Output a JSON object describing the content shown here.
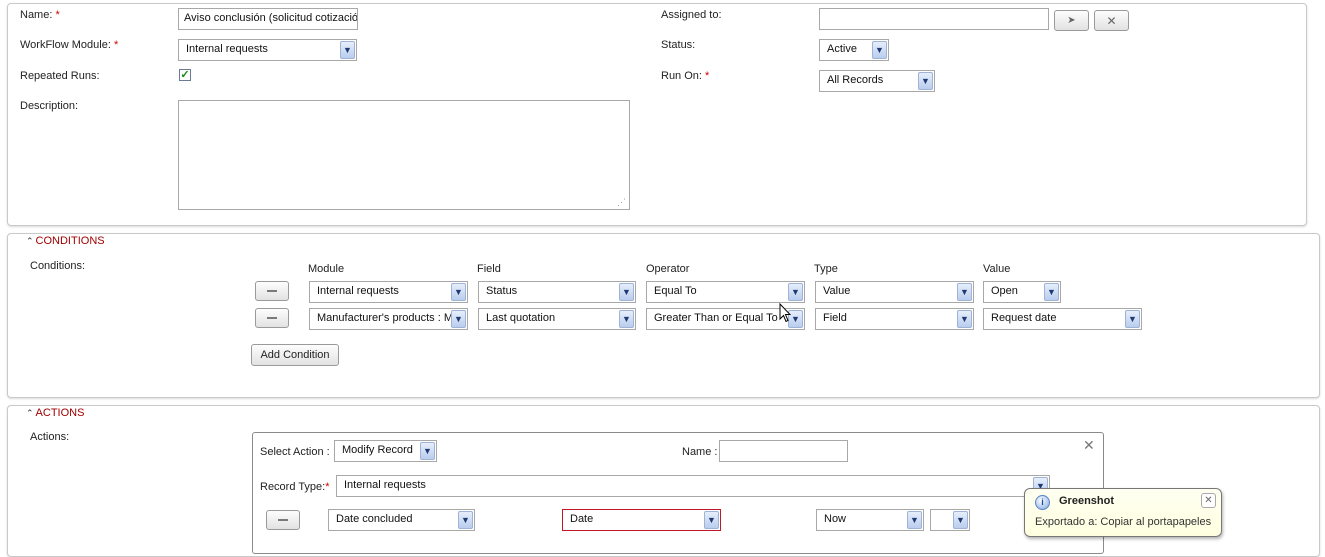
{
  "form": {
    "name_label": "Name:",
    "name_value": "Aviso conclusión (solicitud cotizació",
    "module_label": "WorkFlow Module:",
    "module_value": "Internal requests",
    "repeated_label": "Repeated Runs:",
    "repeated_checked": true,
    "description_label": "Description:",
    "description_value": "",
    "assigned_label": "Assigned to:",
    "assigned_value": "",
    "status_label": "Status:",
    "status_value": "Active",
    "runon_label": "Run On:",
    "runon_value": "All Records",
    "required_mark": "*"
  },
  "conditions": {
    "header": "CONDITIONS",
    "label": "Conditions:",
    "columns": {
      "module": "Module",
      "field": "Field",
      "operator": "Operator",
      "type": "Type",
      "value": "Value"
    },
    "rows": [
      {
        "module": "Internal requests",
        "field": "Status",
        "operator": "Equal To",
        "type": "Value",
        "value": "Open"
      },
      {
        "module": "Manufacturer's products : M",
        "field": "Last quotation",
        "operator": "Greater Than or Equal To",
        "type": "Field",
        "value": "Request date"
      }
    ],
    "add_button": "Add Condition"
  },
  "actions": {
    "header": "ACTIONS",
    "label": "Actions:",
    "select_action_label": "Select Action :",
    "select_action_value": "Modify Record",
    "name_label": "Name :",
    "name_value": "",
    "record_type_label": "Record Type:",
    "record_type_value": "Internal requests",
    "row": {
      "field": "Date concluded",
      "type": "Date",
      "value": "Now",
      "extra": ""
    }
  },
  "notification": {
    "app": "Greenshot",
    "message": "Exportado a: Copiar al portapapeles"
  },
  "icons": {
    "dropdown": "▼",
    "close": "✕",
    "pointer": "➤",
    "chevron_up": "⌃"
  }
}
